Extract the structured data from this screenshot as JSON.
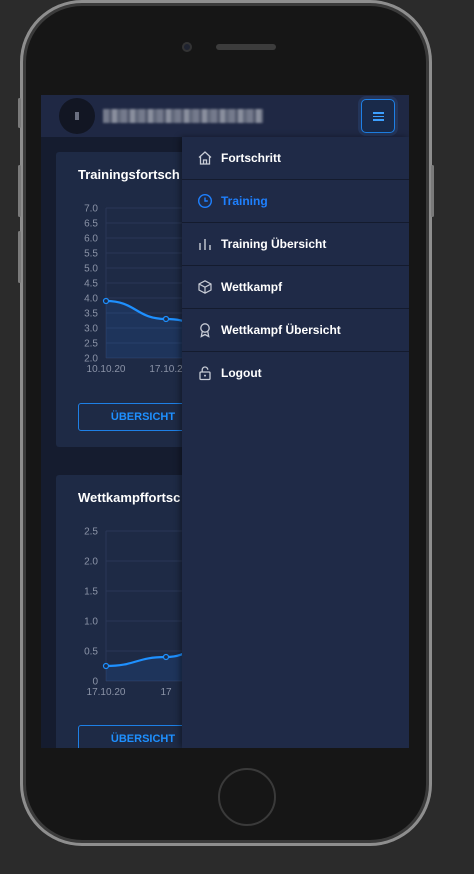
{
  "header": {
    "username_redacted": "",
    "menu_icon": "hamburger-icon"
  },
  "cards": [
    {
      "title": "Trainingsfortsch",
      "button_label": "ÜBERSICHT",
      "chart_data": {
        "type": "line",
        "title": "",
        "xlabel": "",
        "ylabel": "",
        "y_ticks": [
          "7.0",
          "6.5",
          "6.0",
          "5.5",
          "5.0",
          "4.5",
          "4.0",
          "3.5",
          "3.0",
          "2.5",
          "2.0"
        ],
        "x_ticks": [
          "10.10.20",
          "17.10.2"
        ],
        "ylim": [
          2.0,
          7.0
        ],
        "series": [
          {
            "x": [
              "10.10.20",
              "17.10.20",
              "end"
            ],
            "values": [
              3.9,
              3.3,
              3.0
            ]
          }
        ],
        "color": "#1e90ff"
      }
    },
    {
      "title": "Wettkampffortsc",
      "button_label": "ÜBERSICHT",
      "chart_data": {
        "type": "line",
        "title": "",
        "xlabel": "",
        "ylabel": "",
        "y_ticks": [
          "2.5",
          "2.0",
          "1.5",
          "1.0",
          "0.5",
          "0"
        ],
        "x_ticks": [
          "17.10.20",
          "17"
        ],
        "ylim": [
          0,
          2.5
        ],
        "series": [
          {
            "x": [
              "17.10.20",
              "mid",
              "end"
            ],
            "values": [
              0.25,
              0.4,
              0.65
            ]
          }
        ],
        "color": "#1e90ff"
      }
    }
  ],
  "drawer": {
    "items": [
      {
        "label": "Fortschritt",
        "icon": "home-icon",
        "active": false
      },
      {
        "label": "Training",
        "icon": "clock-icon",
        "active": true
      },
      {
        "label": "Training Übersicht",
        "icon": "bar-chart-icon",
        "active": false
      },
      {
        "label": "Wettkampf",
        "icon": "cube-icon",
        "active": false
      },
      {
        "label": "Wettkampf Übersicht",
        "icon": "award-icon",
        "active": false
      },
      {
        "label": "Logout",
        "icon": "lock-icon",
        "active": false
      }
    ]
  },
  "colors": {
    "accent": "#1e80ff",
    "background": "#151c2f",
    "card": "#1e2a45",
    "drawer": "#1f2a47"
  }
}
